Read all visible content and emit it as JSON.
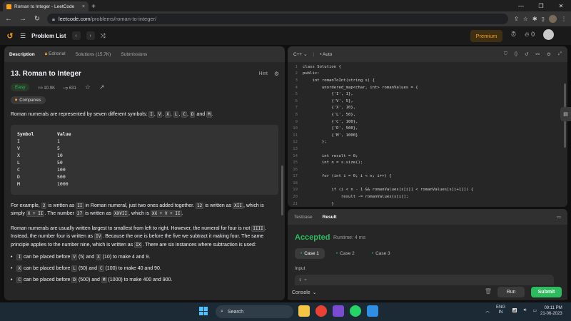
{
  "browser": {
    "tab_title": "Roman to Integer - LeetCode",
    "tab_close": "×",
    "new_tab": "+",
    "url_host": "leetcode.com",
    "url_path": "/problems/roman-to-integer/",
    "window_controls": [
      "—",
      "❐",
      "✕"
    ]
  },
  "lcnav": {
    "logo": "↺",
    "problem_list": "Problem List",
    "prev": "‹",
    "next": "›",
    "shuffle": "⤨",
    "premium": "Premium",
    "streak": "0"
  },
  "problem": {
    "tabs": [
      {
        "label": "Description",
        "active": true
      },
      {
        "label": "Editorial"
      },
      {
        "label": "Solutions (15.7K)"
      },
      {
        "label": "Submissions"
      }
    ],
    "title": "13. Roman to Integer",
    "hint": "Hint",
    "difficulty": "Easy",
    "likes": "10.9K",
    "dislikes": "631",
    "companies": "Companies",
    "intro": "Roman numerals are represented by seven different symbols:",
    "symbols_inline": [
      "I",
      "V",
      "X",
      "L",
      "C",
      "D",
      "M"
    ],
    "and_word": "and",
    "table_header": [
      "Symbol",
      "Value"
    ],
    "table_rows": [
      [
        "I",
        "1"
      ],
      [
        "V",
        "5"
      ],
      [
        "X",
        "10"
      ],
      [
        "L",
        "50"
      ],
      [
        "C",
        "100"
      ],
      [
        "D",
        "500"
      ],
      [
        "M",
        "1000"
      ]
    ],
    "example_para": {
      "t1": "For example,",
      "c1": "2",
      "t2": "is written as",
      "c2": "II",
      "t3": "in Roman numeral, just two ones added together.",
      "c3": "12",
      "t4": "is written as",
      "c4": "XII",
      "t5": ", which is simply",
      "c5": "X + II",
      "t6": ". The number",
      "c6": "27",
      "t7": "is written as",
      "c7": "XXVII",
      "t8": ", which is",
      "c8": "XX + V + II",
      "t9": "."
    },
    "order_para": {
      "t1": "Roman numerals are usually written largest to smallest from left to right. However, the numeral for four is not",
      "c1": "IIII",
      "t2": ". Instead, the number four is written as",
      "c2": "IV",
      "t3": ". Because the one is before the five we subtract it making four. The same principle applies to the number nine, which is written as",
      "c3": "IX",
      "t4": ". There are six instances where subtraction is used:"
    },
    "cases": [
      {
        "c1": "I",
        "t1": "can be placed before",
        "c2": "V",
        "t2": "(5) and",
        "c3": "X",
        "t3": "(10) to make 4 and 9."
      },
      {
        "c1": "X",
        "t1": "can be placed before",
        "c2": "L",
        "t2": "(50) and",
        "c3": "C",
        "t3": "(100) to make 40 and 90."
      },
      {
        "c1": "C",
        "t1": "can be placed before",
        "c2": "D",
        "t2": "(500) and",
        "c3": "M",
        "t3": "(1000) to make 400 and 900."
      }
    ]
  },
  "editor": {
    "language": "C++",
    "mode": "Auto",
    "lines": [
      {
        "n": "1",
        "t": "class Solution {"
      },
      {
        "n": "2",
        "t": "public:"
      },
      {
        "n": "3",
        "t": "    int romanToInt(string s) {"
      },
      {
        "n": "4",
        "t": "        unordered_map<char, int> romanValues = {"
      },
      {
        "n": "5",
        "t": "            {'I', 1},"
      },
      {
        "n": "6",
        "t": "            {'V', 5},"
      },
      {
        "n": "7",
        "t": "            {'X', 10},"
      },
      {
        "n": "8",
        "t": "            {'L', 50},"
      },
      {
        "n": "9",
        "t": "            {'C', 100},"
      },
      {
        "n": "10",
        "t": "            {'D', 500},"
      },
      {
        "n": "11",
        "t": "            {'M', 1000}"
      },
      {
        "n": "12",
        "t": "        };"
      },
      {
        "n": "13",
        "t": ""
      },
      {
        "n": "14",
        "t": "        int result = 0;"
      },
      {
        "n": "15",
        "t": "        int n = s.size();"
      },
      {
        "n": "16",
        "t": ""
      },
      {
        "n": "17",
        "t": "        for (int i = 0; i < n; i++) {"
      },
      {
        "n": "18",
        "t": ""
      },
      {
        "n": "19",
        "t": "            if (i < n - 1 && romanValues[s[i]] < romanValues[s[i+1]]) {"
      },
      {
        "n": "20",
        "t": "                result -= romanValues[s[i]];"
      },
      {
        "n": "21",
        "t": "            }"
      }
    ]
  },
  "result": {
    "tabs": [
      {
        "label": "Testcase"
      },
      {
        "label": "Result",
        "active": true
      }
    ],
    "status": "Accepted",
    "runtime": "Runtime: 4 ms",
    "cases": [
      "Case 1",
      "Case 2",
      "Case 3"
    ],
    "input_label": "Input",
    "input_value": "s ="
  },
  "bottom": {
    "console": "Console",
    "run": "Run",
    "submit": "Submit"
  },
  "taskbar": {
    "search": "Search",
    "lang_top": "ENG",
    "lang_bottom": "IN",
    "time": "09:11 PM",
    "date": "21-06-2023"
  },
  "colors": {
    "accent": "#ffa116",
    "success": "#2cbb5d",
    "panel": "#262626",
    "background": "#0f0f0f"
  }
}
